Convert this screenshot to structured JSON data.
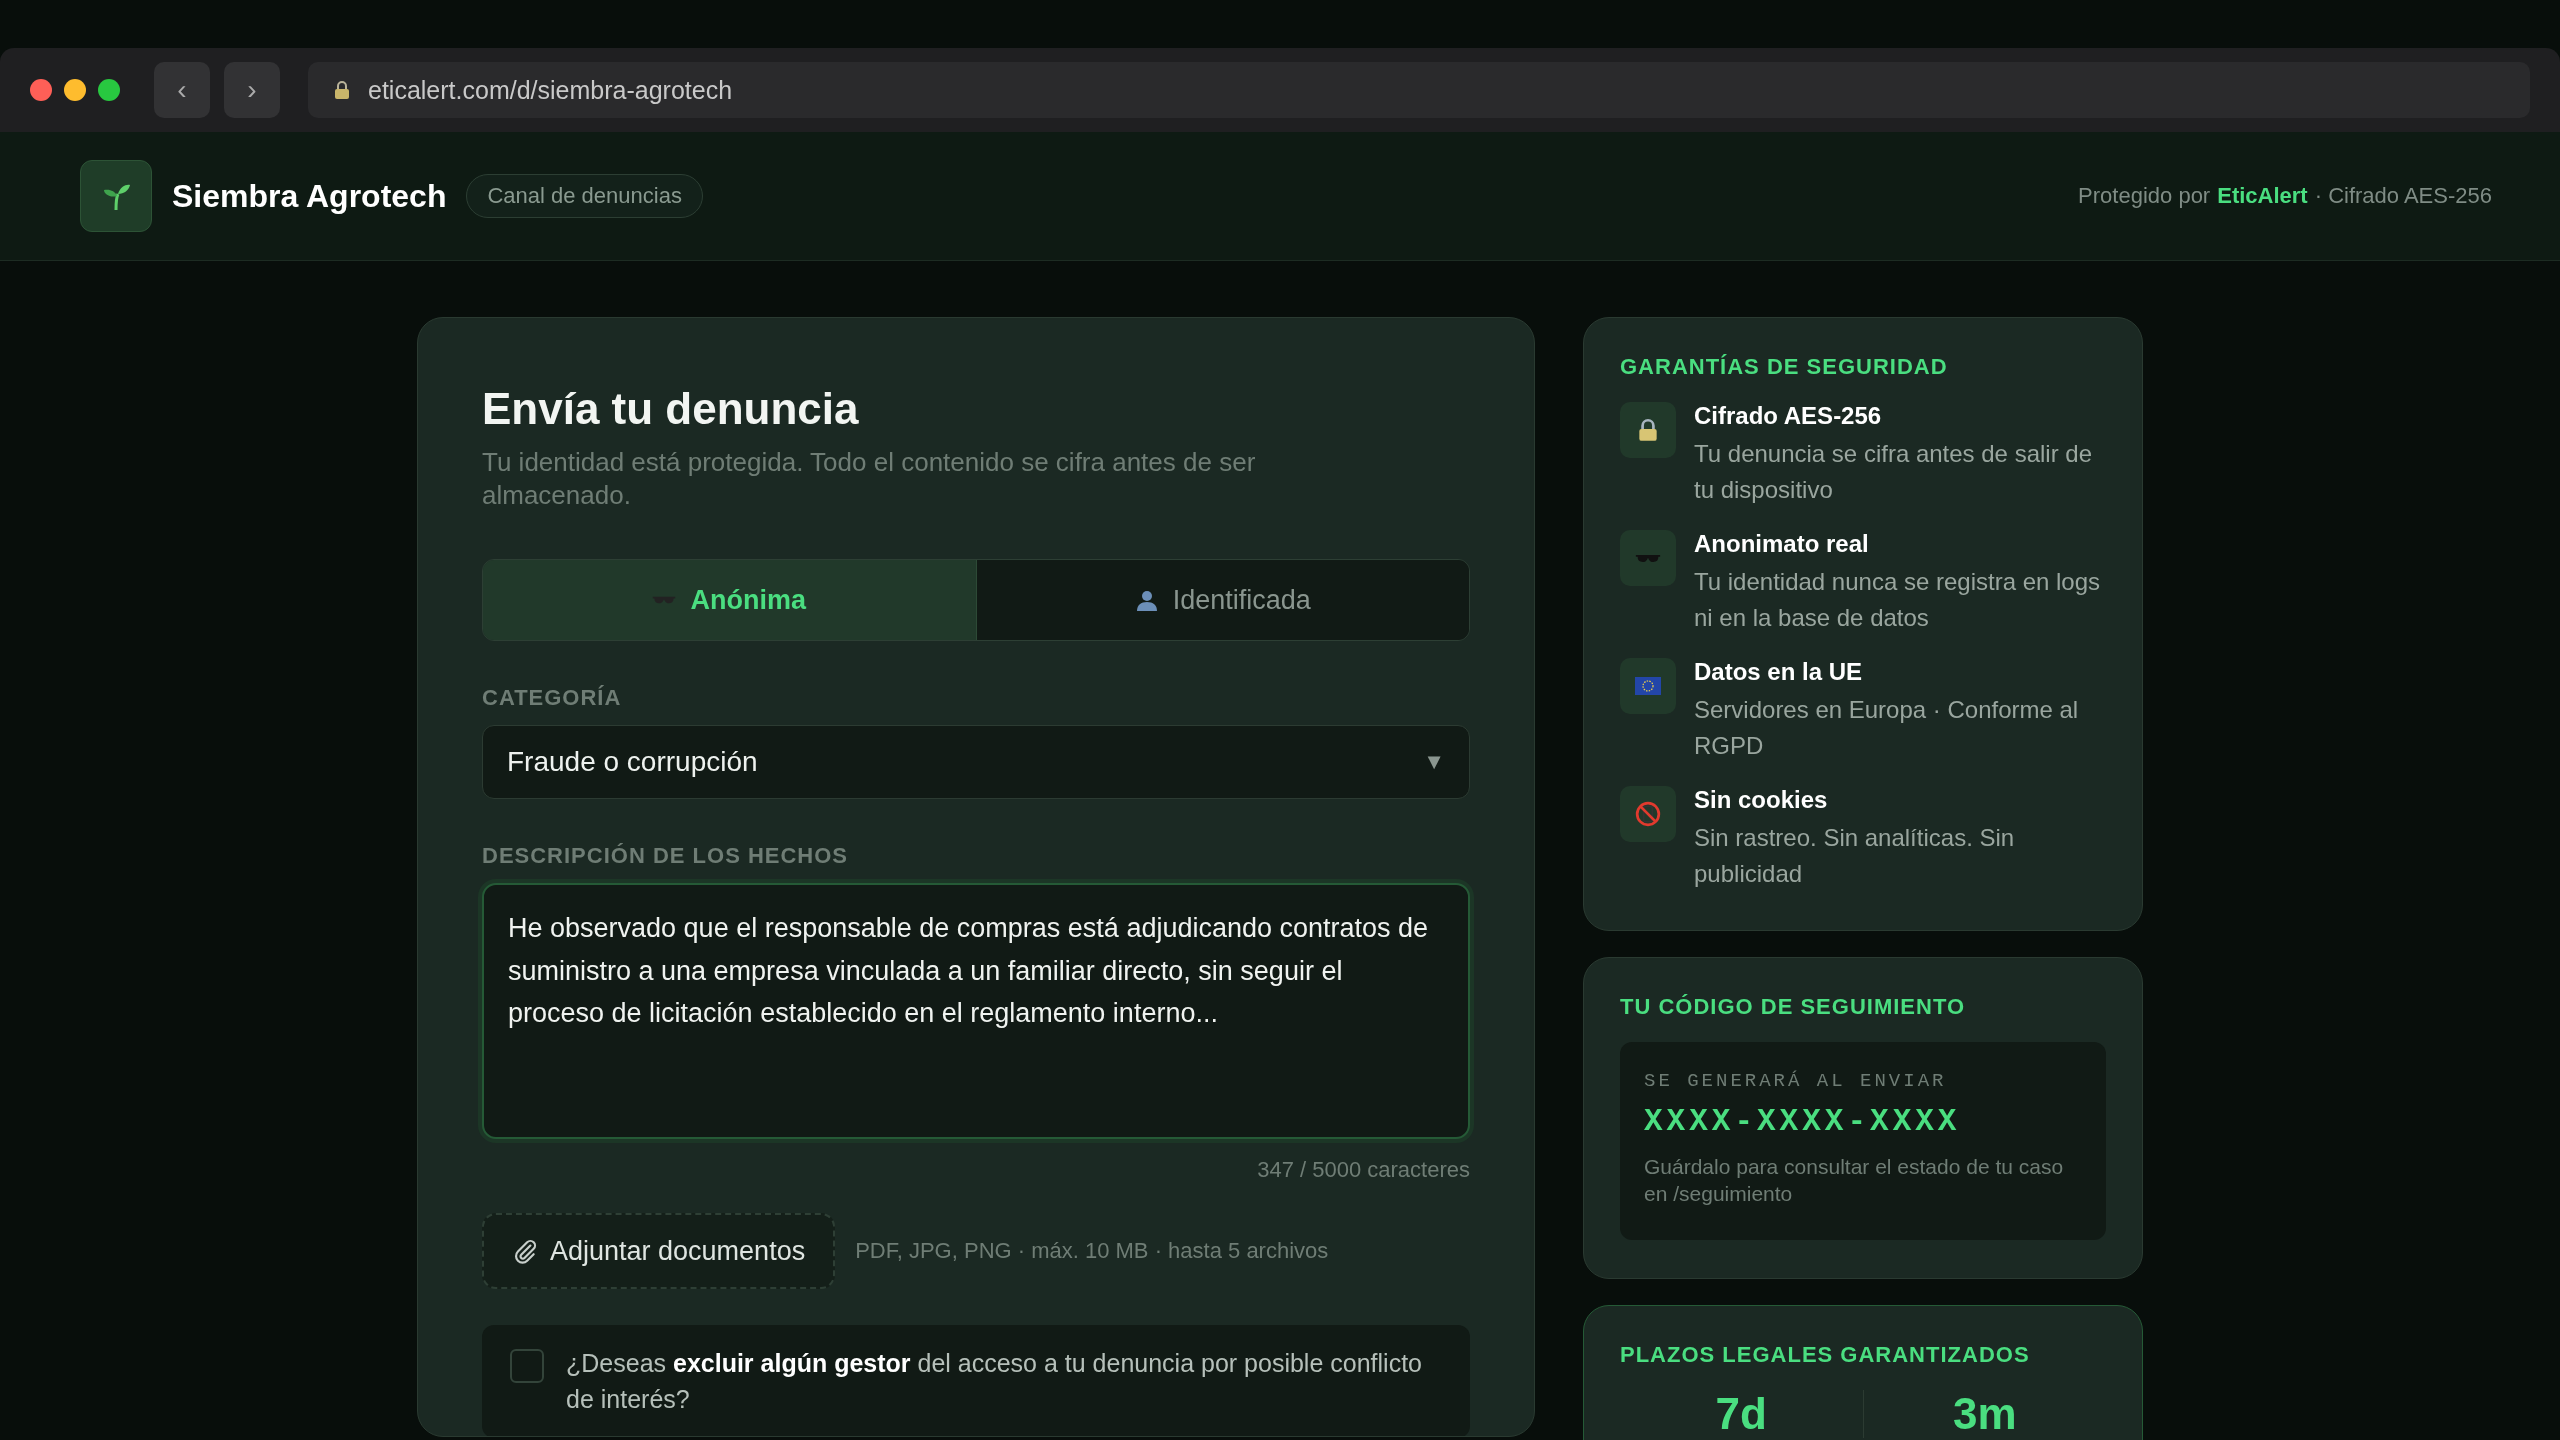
{
  "browser": {
    "back": "‹",
    "forward": "›",
    "url": "eticalert.com/d/siembra-agrotech"
  },
  "header": {
    "brand": "Siembra Agrotech",
    "badge": "Canal de denuncias",
    "protected_prefix": "Protegido por",
    "protected_by": "EticAlert",
    "protected_suffix": "· Cifrado AES-256"
  },
  "form": {
    "title": "Envía tu denuncia",
    "subtitle": "Tu identidad está protegida. Todo el contenido se cifra antes de ser almacenado.",
    "modes": [
      {
        "label": "Anónima",
        "kind": "anonymous",
        "selected": true
      },
      {
        "label": "Identificada",
        "kind": "identified",
        "selected": false
      }
    ],
    "category_label": "CATEGORÍA",
    "category_value": "Fraude o corrupción",
    "category_caret": "▼",
    "description_label": "DESCRIPCIÓN DE LOS HECHOS",
    "description_value": "He observado que el responsable de compras está adjudicando contratos de suministro a una empresa vinculada a un familiar directo, sin seguir el proceso de licitación establecido en el reglamento interno...",
    "char_count": "347 / 5000 caracteres",
    "attach_button": "Adjuntar documentos",
    "attach_hint": "PDF, JPG, PNG · máx. 10 MB · hasta 5 archivos",
    "exclude": {
      "text": "¿Deseas **excluir algún gestor** del acceso a tu denuncia por posible conflicto de interés?",
      "checked": false
    }
  },
  "guarantees": {
    "title": "GARANTÍAS DE SEGURIDAD",
    "items": [
      {
        "kind": "lock",
        "title": "Cifrado AES-256",
        "text": "Tu denuncia se cifra antes de salir de tu dispositivo"
      },
      {
        "kind": "glasses",
        "title": "Anonimato real",
        "text": "Tu identidad nunca se registra en logs ni en la base de datos"
      },
      {
        "kind": "eu",
        "title": "Datos en la UE",
        "text": "Servidores en Europa · Conforme al RGPD"
      },
      {
        "kind": "nocookie",
        "title": "Sin cookies",
        "text": "Sin rastreo. Sin analíticas. Sin publicidad"
      }
    ]
  },
  "tracking": {
    "title": "TU CÓDIGO DE SEGUIMIENTO",
    "caption": "SE GENERARÁ AL ENVIAR",
    "code": "XXXX-XXXX-XXXX",
    "hint": "Guárdalo para consultar el estado de tu caso en /seguimiento"
  },
  "deadlines": {
    "title": "PLAZOS LEGALES GARANTIZADOS",
    "items": [
      {
        "value": "7d"
      },
      {
        "value": "3m"
      }
    ]
  }
}
